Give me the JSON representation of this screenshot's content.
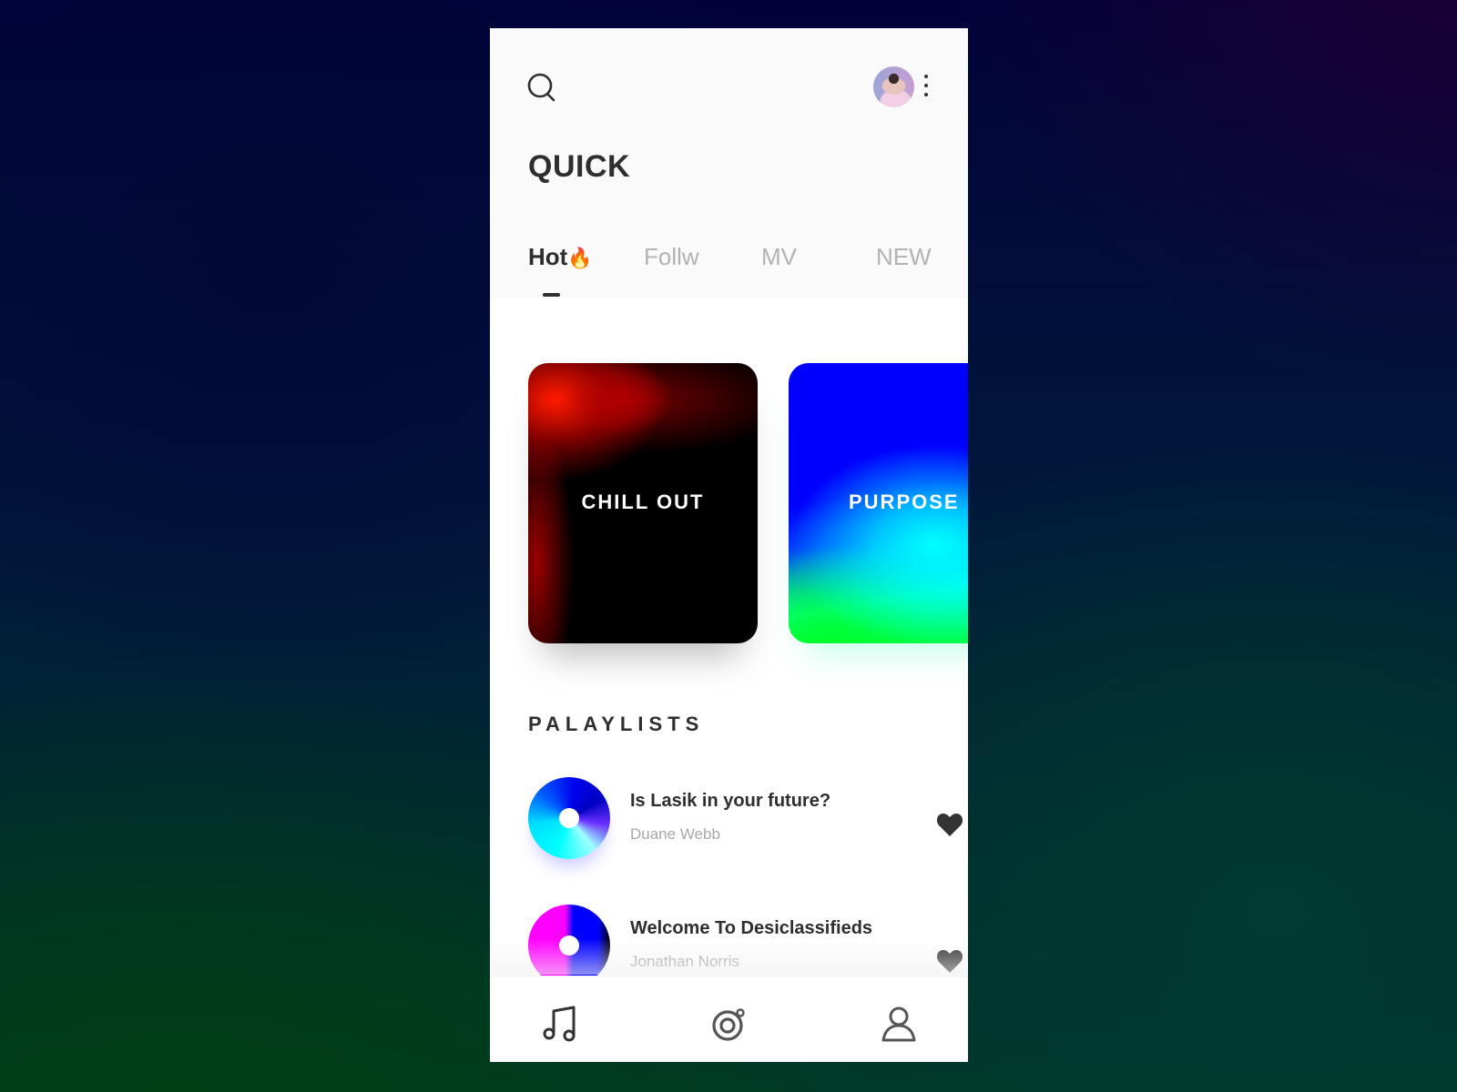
{
  "header": {
    "search_icon": "search-icon",
    "avatar_alt": "user avatar",
    "more_icon": "more-vertical-icon"
  },
  "page_title": "QUICK",
  "tabs": [
    {
      "label": "Hot",
      "emoji": "🔥",
      "active": true
    },
    {
      "label": "Follw",
      "active": false
    },
    {
      "label": "MV",
      "active": false
    },
    {
      "label": "NEW",
      "active": false
    }
  ],
  "featured_cards": [
    {
      "label": "CHILL OUT"
    },
    {
      "label": "PURPOSE"
    }
  ],
  "playlists": {
    "title": "PALAYLISTS",
    "items": [
      {
        "title": "Is Lasik in your future?",
        "artist": "Duane Webb",
        "liked": true
      },
      {
        "title": "Welcome To Desiclassifieds",
        "artist": "Jonathan Norris",
        "liked": true
      }
    ]
  },
  "bottom_nav": [
    {
      "name": "music",
      "icon": "music-note-icon",
      "active": true
    },
    {
      "name": "discover",
      "icon": "disc-icon",
      "active": false
    },
    {
      "name": "profile",
      "icon": "user-icon",
      "active": false
    }
  ],
  "colors": {
    "text_primary": "#2e2e2e",
    "text_muted": "#b3b3b3",
    "header_bg": "#fafafa"
  }
}
